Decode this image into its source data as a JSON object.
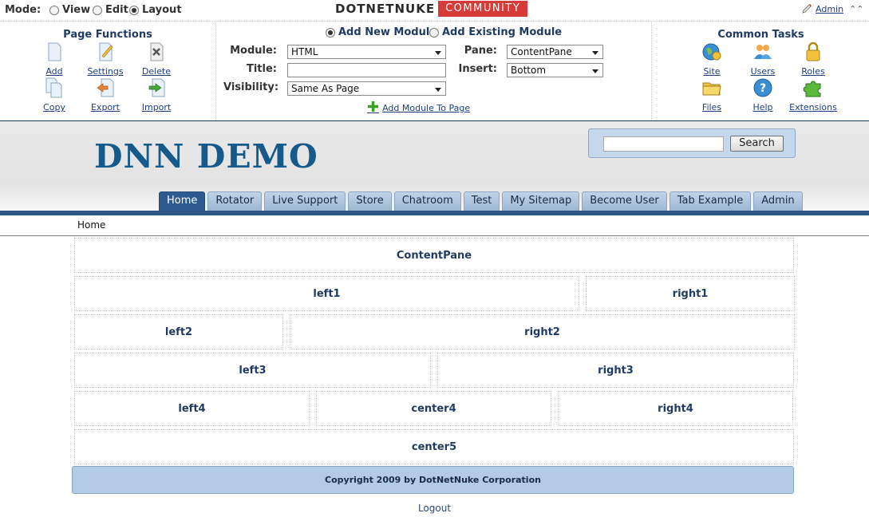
{
  "modebar": {
    "label": "Mode:",
    "options": [
      "View",
      "Edit",
      "Layout"
    ],
    "selected": "Layout",
    "logo_left": "DOTNETNUKE",
    "logo_right": "COMMUNITY",
    "admin_link": "Admin",
    "collapse_glyph": "⌃⌃"
  },
  "page_functions": {
    "title": "Page Functions",
    "items": [
      {
        "label": "Add",
        "icon": "page-add-icon"
      },
      {
        "label": "Settings",
        "icon": "page-settings-icon"
      },
      {
        "label": "Delete",
        "icon": "page-delete-icon"
      },
      {
        "label": "Copy",
        "icon": "page-copy-icon"
      },
      {
        "label": "Export",
        "icon": "page-export-icon"
      },
      {
        "label": "Import",
        "icon": "page-import-icon"
      }
    ]
  },
  "module_form": {
    "add_new": "Add New Module",
    "add_existing": "Add Existing Module",
    "selected": "Add New Module",
    "module_label": "Module:",
    "module_value": "HTML",
    "title_label": "Title:",
    "title_value": "",
    "visibility_label": "Visibility:",
    "visibility_value": "Same As Page",
    "pane_label": "Pane:",
    "pane_value": "ContentPane",
    "insert_label": "Insert:",
    "insert_value": "Bottom",
    "add_to_page": "Add Module To Page"
  },
  "common_tasks": {
    "title": "Common Tasks",
    "items": [
      {
        "label": "Site",
        "icon": "site-icon"
      },
      {
        "label": "Users",
        "icon": "users-icon"
      },
      {
        "label": "Roles",
        "icon": "roles-icon"
      },
      {
        "label": "Files",
        "icon": "files-icon"
      },
      {
        "label": "Help",
        "icon": "help-icon"
      },
      {
        "label": "Extensions",
        "icon": "extensions-icon"
      }
    ]
  },
  "site": {
    "title": "DNN DEMO",
    "search_button": "Search",
    "search_value": "",
    "menu": [
      "Home",
      "Rotator",
      "Live Support",
      "Store",
      "Chatroom",
      "Test",
      "My Sitemap",
      "Become User",
      "Tab Example",
      "Admin"
    ],
    "active_tab": "Home",
    "breadcrumb": "Home"
  },
  "panes": {
    "content": "ContentPane",
    "left1": "left1",
    "right1": "right1",
    "left2": "left2",
    "right2": "right2",
    "left3": "left3",
    "right3": "right3",
    "left4": "left4",
    "center4": "center4",
    "right4": "right4",
    "center5": "center5"
  },
  "footer": {
    "copyright": "Copyright 2009 by DotNetNuke Corporation",
    "logout": "Logout"
  },
  "colors": {
    "brand_blue": "#155a8a",
    "nav_bar": "#2c588a",
    "logo_red": "#d63b38",
    "footer_bg": "#b3cbe4"
  }
}
